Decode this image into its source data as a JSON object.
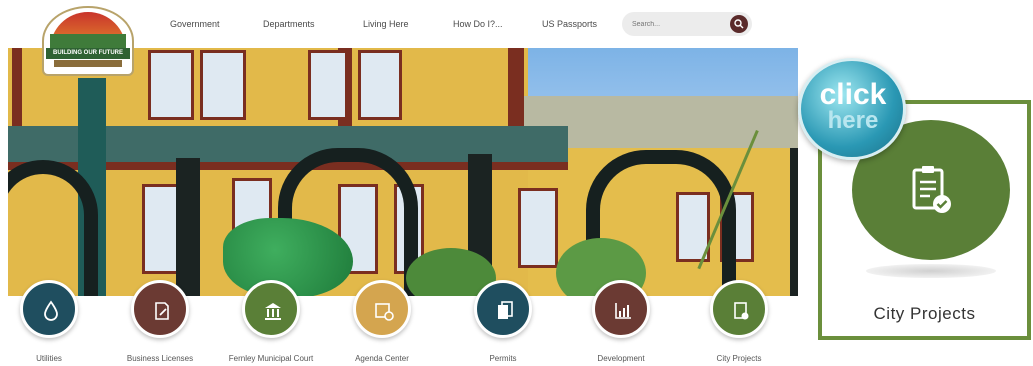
{
  "header": {
    "logo_text": "BUILDING OUR FUTURE",
    "nav": [
      "Government",
      "Departments",
      "Living Here",
      "How Do I?...",
      "US Passports"
    ],
    "search_placeholder": "Search..."
  },
  "quick_links": [
    {
      "label": "Utilities",
      "color": "#1f4e5f",
      "icon": "water-drop-icon"
    },
    {
      "label": "Business Licenses",
      "color": "#6b3a33",
      "icon": "document-pen-icon"
    },
    {
      "label": "Fernley Municipal Court",
      "color": "#5a7f37",
      "icon": "courthouse-icon"
    },
    {
      "label": "Agenda Center",
      "color": "#d4a54f",
      "icon": "calendar-clock-icon"
    },
    {
      "label": "Permits",
      "color": "#1f4e5f",
      "icon": "documents-icon"
    },
    {
      "label": "Development",
      "color": "#6b3a33",
      "icon": "chart-icon"
    },
    {
      "label": "City Projects",
      "color": "#5a7f37",
      "icon": "clipboard-check-icon"
    }
  ],
  "callout": {
    "badge_line1": "click",
    "badge_line2": "here",
    "title": "City Projects",
    "border_color": "#6b8f3c"
  }
}
